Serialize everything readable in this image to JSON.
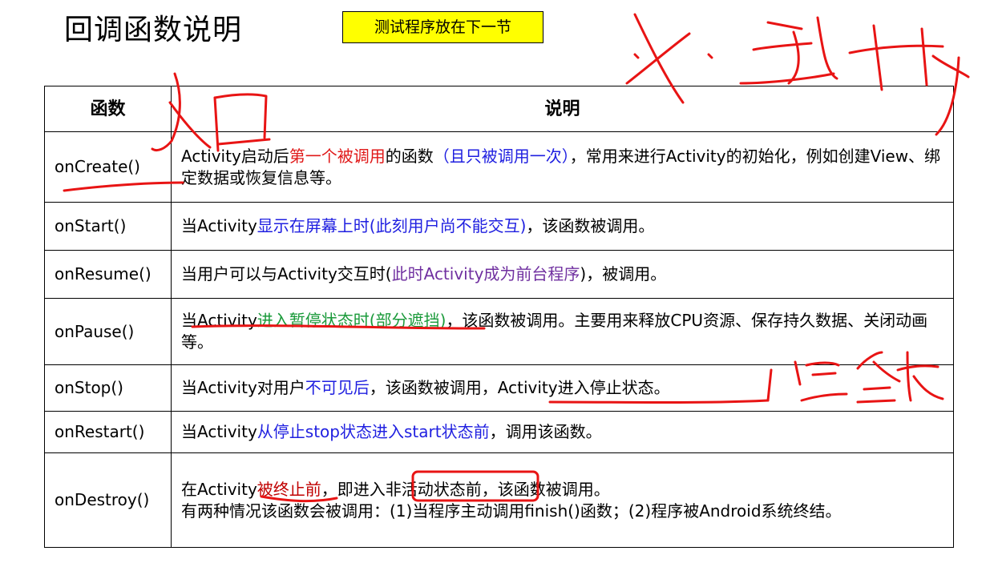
{
  "header": {
    "title": "回调函数说明",
    "note": "测试程序放在下一节"
  },
  "table": {
    "headers": {
      "function": "函数",
      "description": "说明"
    },
    "rows": [
      {
        "fn": "onCreate()",
        "d1": "Activity启动后",
        "d2": "第一个被调用",
        "d3": "的函数",
        "d4": "（且只被调用一次）",
        "d5": "，常用来进行Activity的初始化，例如创建View、绑定数据或恢复信息等。"
      },
      {
        "fn": "onStart()",
        "d1": "当Activity",
        "d2": "显示在屏幕上时(此刻用户尚不能交互)",
        "d3": "，该函数被调用。"
      },
      {
        "fn": "onResume()",
        "d1": "当用户可以与Activity交互时(",
        "d2": "此时Activity成为前台程序",
        "d3": ")，被调用。"
      },
      {
        "fn": "onPause()",
        "d1": "当Activity",
        "d2": "进入暂停状态时(部分遮挡)",
        "d3": "，该函数被调用。主要用来释放CPU资源、保存持久数据、关闭动画等。"
      },
      {
        "fn": "onStop()",
        "d1": "当Activity对用户",
        "d2": "不可见后",
        "d3": "，该函数被调用，Activity进入停止状态。"
      },
      {
        "fn": "onRestart()",
        "d1": "当Activity",
        "d2": "从停止stop状态进入start状态前",
        "d3": "，调用该函数。"
      },
      {
        "fn": "onDestroy()",
        "d1": "在Activity",
        "d2": "被终止前",
        "d3": "，即进入",
        "d4": "非活动状态前",
        "d5": "，该函数被调用。",
        "line2": "有两种情况该函数会被调用：(1)当程序主动调用finish()函数；(2)程序被Android系统终结。"
      }
    ]
  },
  "annotations": {
    "color": "#e81414",
    "glyph_entry": "入口",
    "glyph_top": "×选节",
    "glyph_stop": "完全遮"
  }
}
